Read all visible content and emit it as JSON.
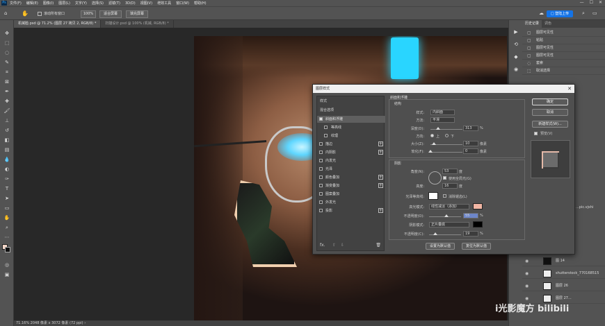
{
  "menubar": {
    "logo": "Ps",
    "items": [
      "文件(F)",
      "编辑(E)",
      "图像(I)",
      "图层(L)",
      "文字(Y)",
      "选择(S)",
      "滤镜(T)",
      "3D(D)",
      "视图(V)",
      "增效工具",
      "窗口(W)",
      "帮助(H)"
    ],
    "window_controls": [
      "—",
      "☐",
      "✕"
    ]
  },
  "optionsbar": {
    "scroll_all_label": "滚动所有窗口",
    "zoom_value": "100%",
    "fit_screen": "适合屏幕",
    "fill_screen": "填充屏幕",
    "share_label": "□ 登陆上传"
  },
  "tabs": [
    {
      "label": "机械脸.psd @ 71.2% (图层 27 拷贝 2, RGB/8) *",
      "active": true
    },
    {
      "label": "扫描设计.psd @ 100% (机械, RGB/8) *",
      "active": false
    }
  ],
  "statusbar": {
    "text": "71.16%   2048 像素 x 3072 像素 (72 ppi)   ›"
  },
  "history_panel": {
    "tabs": [
      "历史记录",
      "调色"
    ],
    "items": [
      "图层可见性",
      "粘贴",
      "图层可见性",
      "图层可见性",
      "套索",
      "取消选择"
    ],
    "layers": [
      "图 14",
      "shutterstock_770168515",
      "图层 26",
      "图层 27..."
    ],
    "cut_text": "...pic.vjshi"
  },
  "watermark": "i光影魔方 bilibili",
  "dialog": {
    "title": "图层样式",
    "styles_header": "样式",
    "blend_options": "混合选项",
    "style_items": [
      {
        "label": "斜面和浮雕",
        "checked": true,
        "plus": false
      },
      {
        "label": "等高线",
        "checked": false,
        "plus": false
      },
      {
        "label": "纹理",
        "checked": false,
        "plus": false
      },
      {
        "label": "描边",
        "checked": false,
        "plus": true
      },
      {
        "label": "内阴影",
        "checked": false,
        "plus": true
      },
      {
        "label": "内发光",
        "checked": false,
        "plus": false
      },
      {
        "label": "光泽",
        "checked": false,
        "plus": false
      },
      {
        "label": "颜色叠加",
        "checked": false,
        "plus": true
      },
      {
        "label": "渐变叠加",
        "checked": false,
        "plus": true
      },
      {
        "label": "图案叠加",
        "checked": false,
        "plus": false
      },
      {
        "label": "外发光",
        "checked": false,
        "plus": false
      },
      {
        "label": "投影",
        "checked": false,
        "plus": true
      }
    ],
    "fx_label": "fx.",
    "bevel": {
      "group_title": "斜面和浮雕",
      "structure": "结构",
      "style_label": "样式:",
      "style_value": "内斜面",
      "method_label": "方法:",
      "method_value": "平滑",
      "depth_label": "深度(D):",
      "depth_value": "313",
      "depth_unit": "%",
      "direction_label": "方向:",
      "dir_up": "上",
      "dir_down": "下",
      "size_label": "大小(Z):",
      "size_value": "10",
      "size_unit": "像素",
      "soften_label": "软化(F):",
      "soften_value": "0",
      "soften_unit": "像素"
    },
    "shading": {
      "title": "阴影",
      "angle_label": "角度(N):",
      "angle_value": "53",
      "angle_unit": "度",
      "global_light": "使用全局光(G)",
      "altitude_label": "高度:",
      "altitude_value": "16",
      "altitude_unit": "度",
      "gloss_label": "光泽等高线:",
      "anti_alias": "消除锯齿(L)",
      "highlight_mode_label": "高光模式:",
      "highlight_mode_value": "线性减淡（添加）",
      "highlight_opacity_label": "不透明度(O):",
      "highlight_opacity_value": "55",
      "shadow_mode_label": "阴影模式:",
      "shadow_mode_value": "正片叠底",
      "shadow_opacity_label": "不透明度(C):",
      "shadow_opacity_value": "19",
      "pct": "%",
      "highlight_color": "#f2b6a4",
      "shadow_color": "#000000"
    },
    "set_default": "设置为默认值",
    "reset_default": "复位为默认值",
    "ok": "确定",
    "cancel": "取消",
    "new_style": "新建样式(W)...",
    "preview_label": "预览(V)"
  }
}
